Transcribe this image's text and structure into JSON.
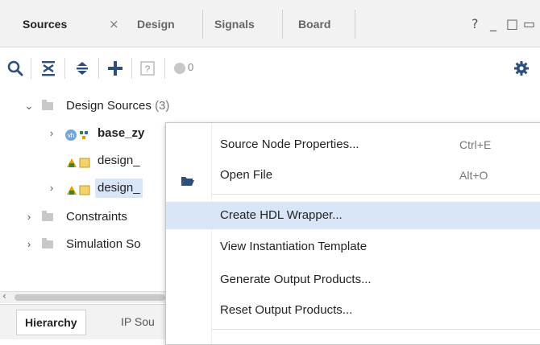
{
  "tabs": [
    {
      "label": "Sources",
      "active": true
    },
    {
      "label": "Design",
      "active": false
    },
    {
      "label": "Signals",
      "active": false
    },
    {
      "label": "Board",
      "active": false
    }
  ],
  "tab_close_glyph": "×",
  "window_controls": {
    "help": "?",
    "minimize": "_",
    "restore": "□",
    "float": "▭"
  },
  "toolbar": {
    "counter_value": "0"
  },
  "tree": {
    "design_sources": {
      "label": "Design Sources",
      "count": "(3)"
    },
    "items": [
      {
        "label": "base_zy",
        "bold": true,
        "icon": "vhdl-file-icon"
      },
      {
        "label": "design_",
        "bold": false,
        "icon": "block-design-icon"
      },
      {
        "label": "design_",
        "bold": false,
        "icon": "block-design-icon"
      }
    ],
    "constraints": "Constraints",
    "simulation": "Simulation So"
  },
  "bottom_tabs": {
    "hierarchy": "Hierarchy",
    "ip_sources": "IP Sou"
  },
  "context_menu": {
    "items": [
      {
        "label": "Source Node Properties...",
        "shortcut": "Ctrl+E"
      },
      {
        "label": "Open File",
        "shortcut": "Alt+O"
      },
      {
        "label": "Create HDL Wrapper...",
        "shortcut": ""
      },
      {
        "label": "View Instantiation Template",
        "shortcut": ""
      },
      {
        "label": "Generate Output Products...",
        "shortcut": ""
      },
      {
        "label": "Reset Output Products...",
        "shortcut": ""
      }
    ],
    "highlighted_index": 2
  },
  "colors": {
    "highlight": "#d8e6f7",
    "accent_blue": "#2f6cb5",
    "tab_bar": "#f2f2f2"
  }
}
